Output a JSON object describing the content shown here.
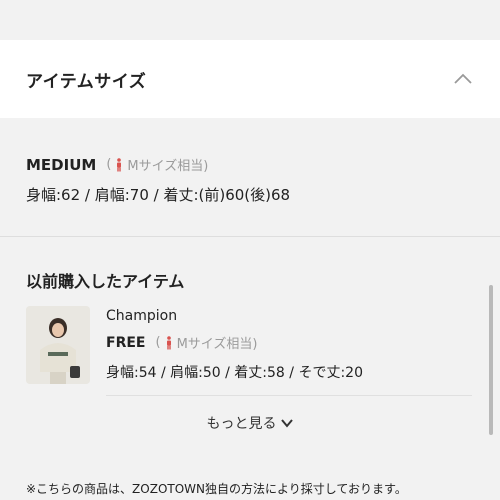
{
  "section": {
    "title": "アイテムサイズ"
  },
  "my_size": {
    "name": "MEDIUM",
    "equivalent_open": "(",
    "equivalent_text": "Mサイズ相当)",
    "measurements": "身幅:62 / 肩幅:70 / 着丈:(前)60(後)68"
  },
  "previous": {
    "title": "以前購入したアイテム",
    "items": [
      {
        "brand": "Champion",
        "size_name": "FREE",
        "equivalent_open": "(",
        "equivalent_text": "Mサイズ相当)",
        "measurements": "身幅:54 / 肩幅:50 / 着丈:58 / そで丈:20"
      }
    ]
  },
  "more_label": "もっと見る",
  "note": "※こちらの商品は、ZOZOTOWN独自の方法により採寸しております。",
  "colors": {
    "accent_person": "#d9534f",
    "muted": "#9b9b9b"
  },
  "icons": {
    "collapse": "chevron-up-icon",
    "person": "person-icon",
    "expand": "chevron-down-icon"
  }
}
